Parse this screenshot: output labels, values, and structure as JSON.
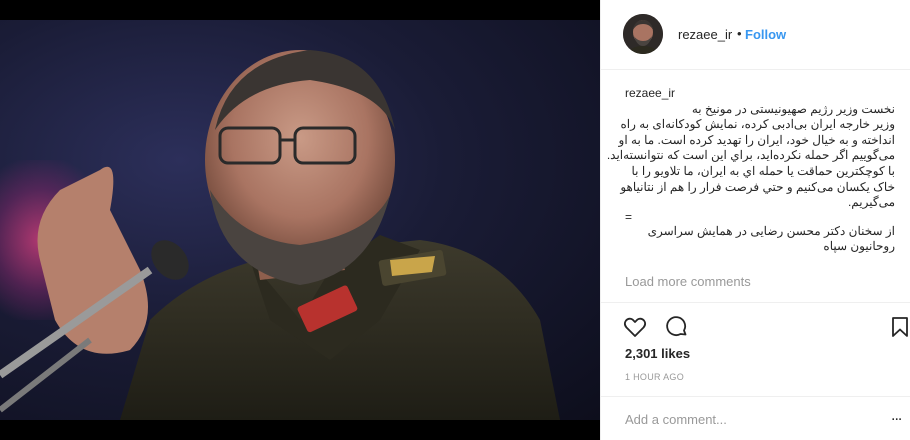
{
  "post": {
    "username": "rezaee_ir",
    "separator": "•",
    "follow_label": "Follow",
    "caption_user": "rezaee_ir",
    "caption_lines": [
      "نخست وزیر رژیم صهیونیستی در مونیخ به",
      "وزیر خارجه ایران بی‌ادبی کرده، نمایش کودکانه‌ای به راه",
      "انداخته و به خیال خود، ایران را تهدید کرده است. ما به او",
      "می‌گوییم اگر حمله نکرده‌اید، براي این است که نتوانسته‌اید.",
      "با کوچکترین حماقت یا حمله اي به ایران، ما تلاویو را با",
      "خاک یکسان می‌کنیم و حتي فرصت فرار را هم از نتانیاهو",
      "می‌گیریم."
    ],
    "caption_separator": "=",
    "caption_footer": [
      "از سخنان دکتر محسن رضایی در همایش سراسری",
      "روحانیون سپاه"
    ],
    "load_more": "Load more comments",
    "likes": "2,301 likes",
    "time": "1 HOUR AGO",
    "comment_placeholder": "Add a comment...",
    "more_options": "...",
    "icons": {
      "like": "heart-icon",
      "comment": "comment-icon",
      "save": "bookmark-icon",
      "more": "more-options-icon"
    }
  },
  "colors": {
    "accent": "#3897f0",
    "text": "#262626",
    "muted": "#999999",
    "border": "#efefef"
  }
}
